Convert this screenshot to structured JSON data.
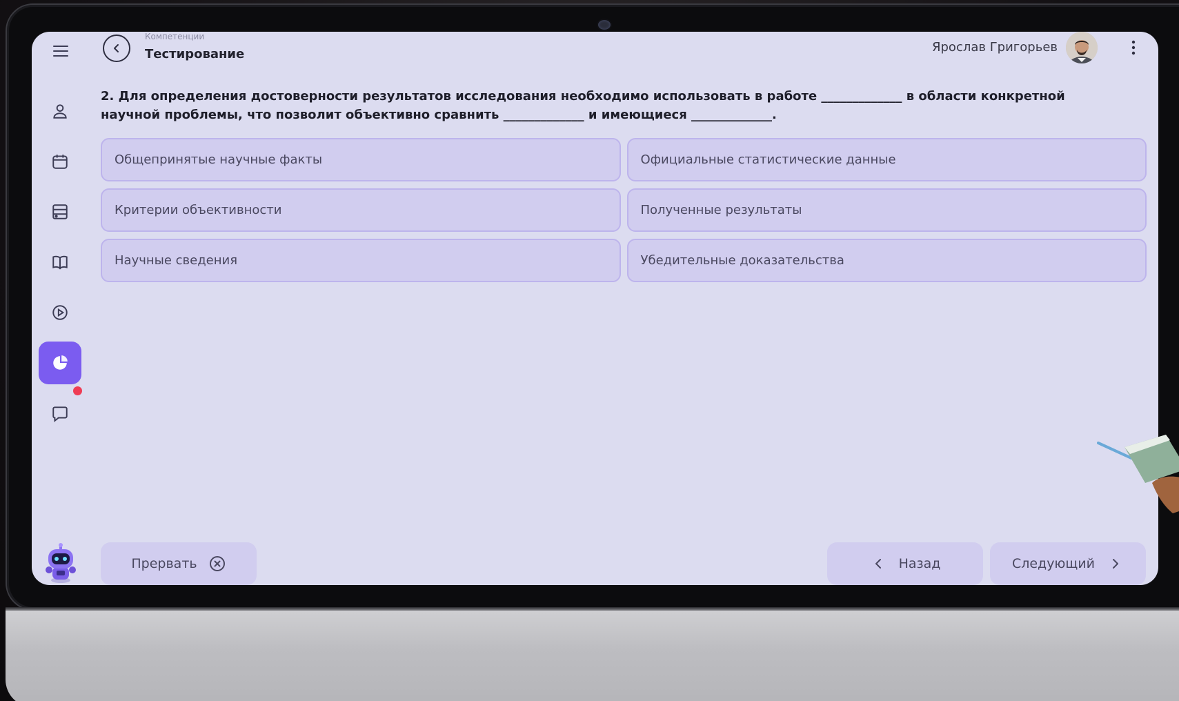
{
  "header": {
    "breadcrumb": "Компетенции",
    "title": "Тестирование",
    "user_name": "Ярослав Григорьев"
  },
  "question": {
    "text": "2. Для определения достоверности результатов исследования необходимо использовать в работе _____________ в области конкретной научной проблемы, что позволит объективно сравнить _____________ и имеющиеся _____________."
  },
  "options": [
    {
      "label": "Общепринятые научные факты"
    },
    {
      "label": "Официальные статистические данные"
    },
    {
      "label": "Критерии объективности"
    },
    {
      "label": "Полученные результаты"
    },
    {
      "label": "Научные сведения"
    },
    {
      "label": "Убедительные  доказательства"
    }
  ],
  "footer": {
    "abort_label": "Прервать",
    "back_label": "Назад",
    "next_label": "Следующий"
  },
  "sidebar": {
    "items": [
      {
        "icon": "user-icon"
      },
      {
        "icon": "calendar-icon"
      },
      {
        "icon": "archive-icon"
      },
      {
        "icon": "book-icon"
      },
      {
        "icon": "play-icon"
      },
      {
        "icon": "pie-chart-icon",
        "active": true
      },
      {
        "icon": "chat-icon",
        "has_notification": true
      }
    ]
  },
  "colors": {
    "screen_bg": "#dcdcf0",
    "accent": "#7b5cf0",
    "option_bg": "#d1cdef",
    "notification": "#ef3c55"
  }
}
